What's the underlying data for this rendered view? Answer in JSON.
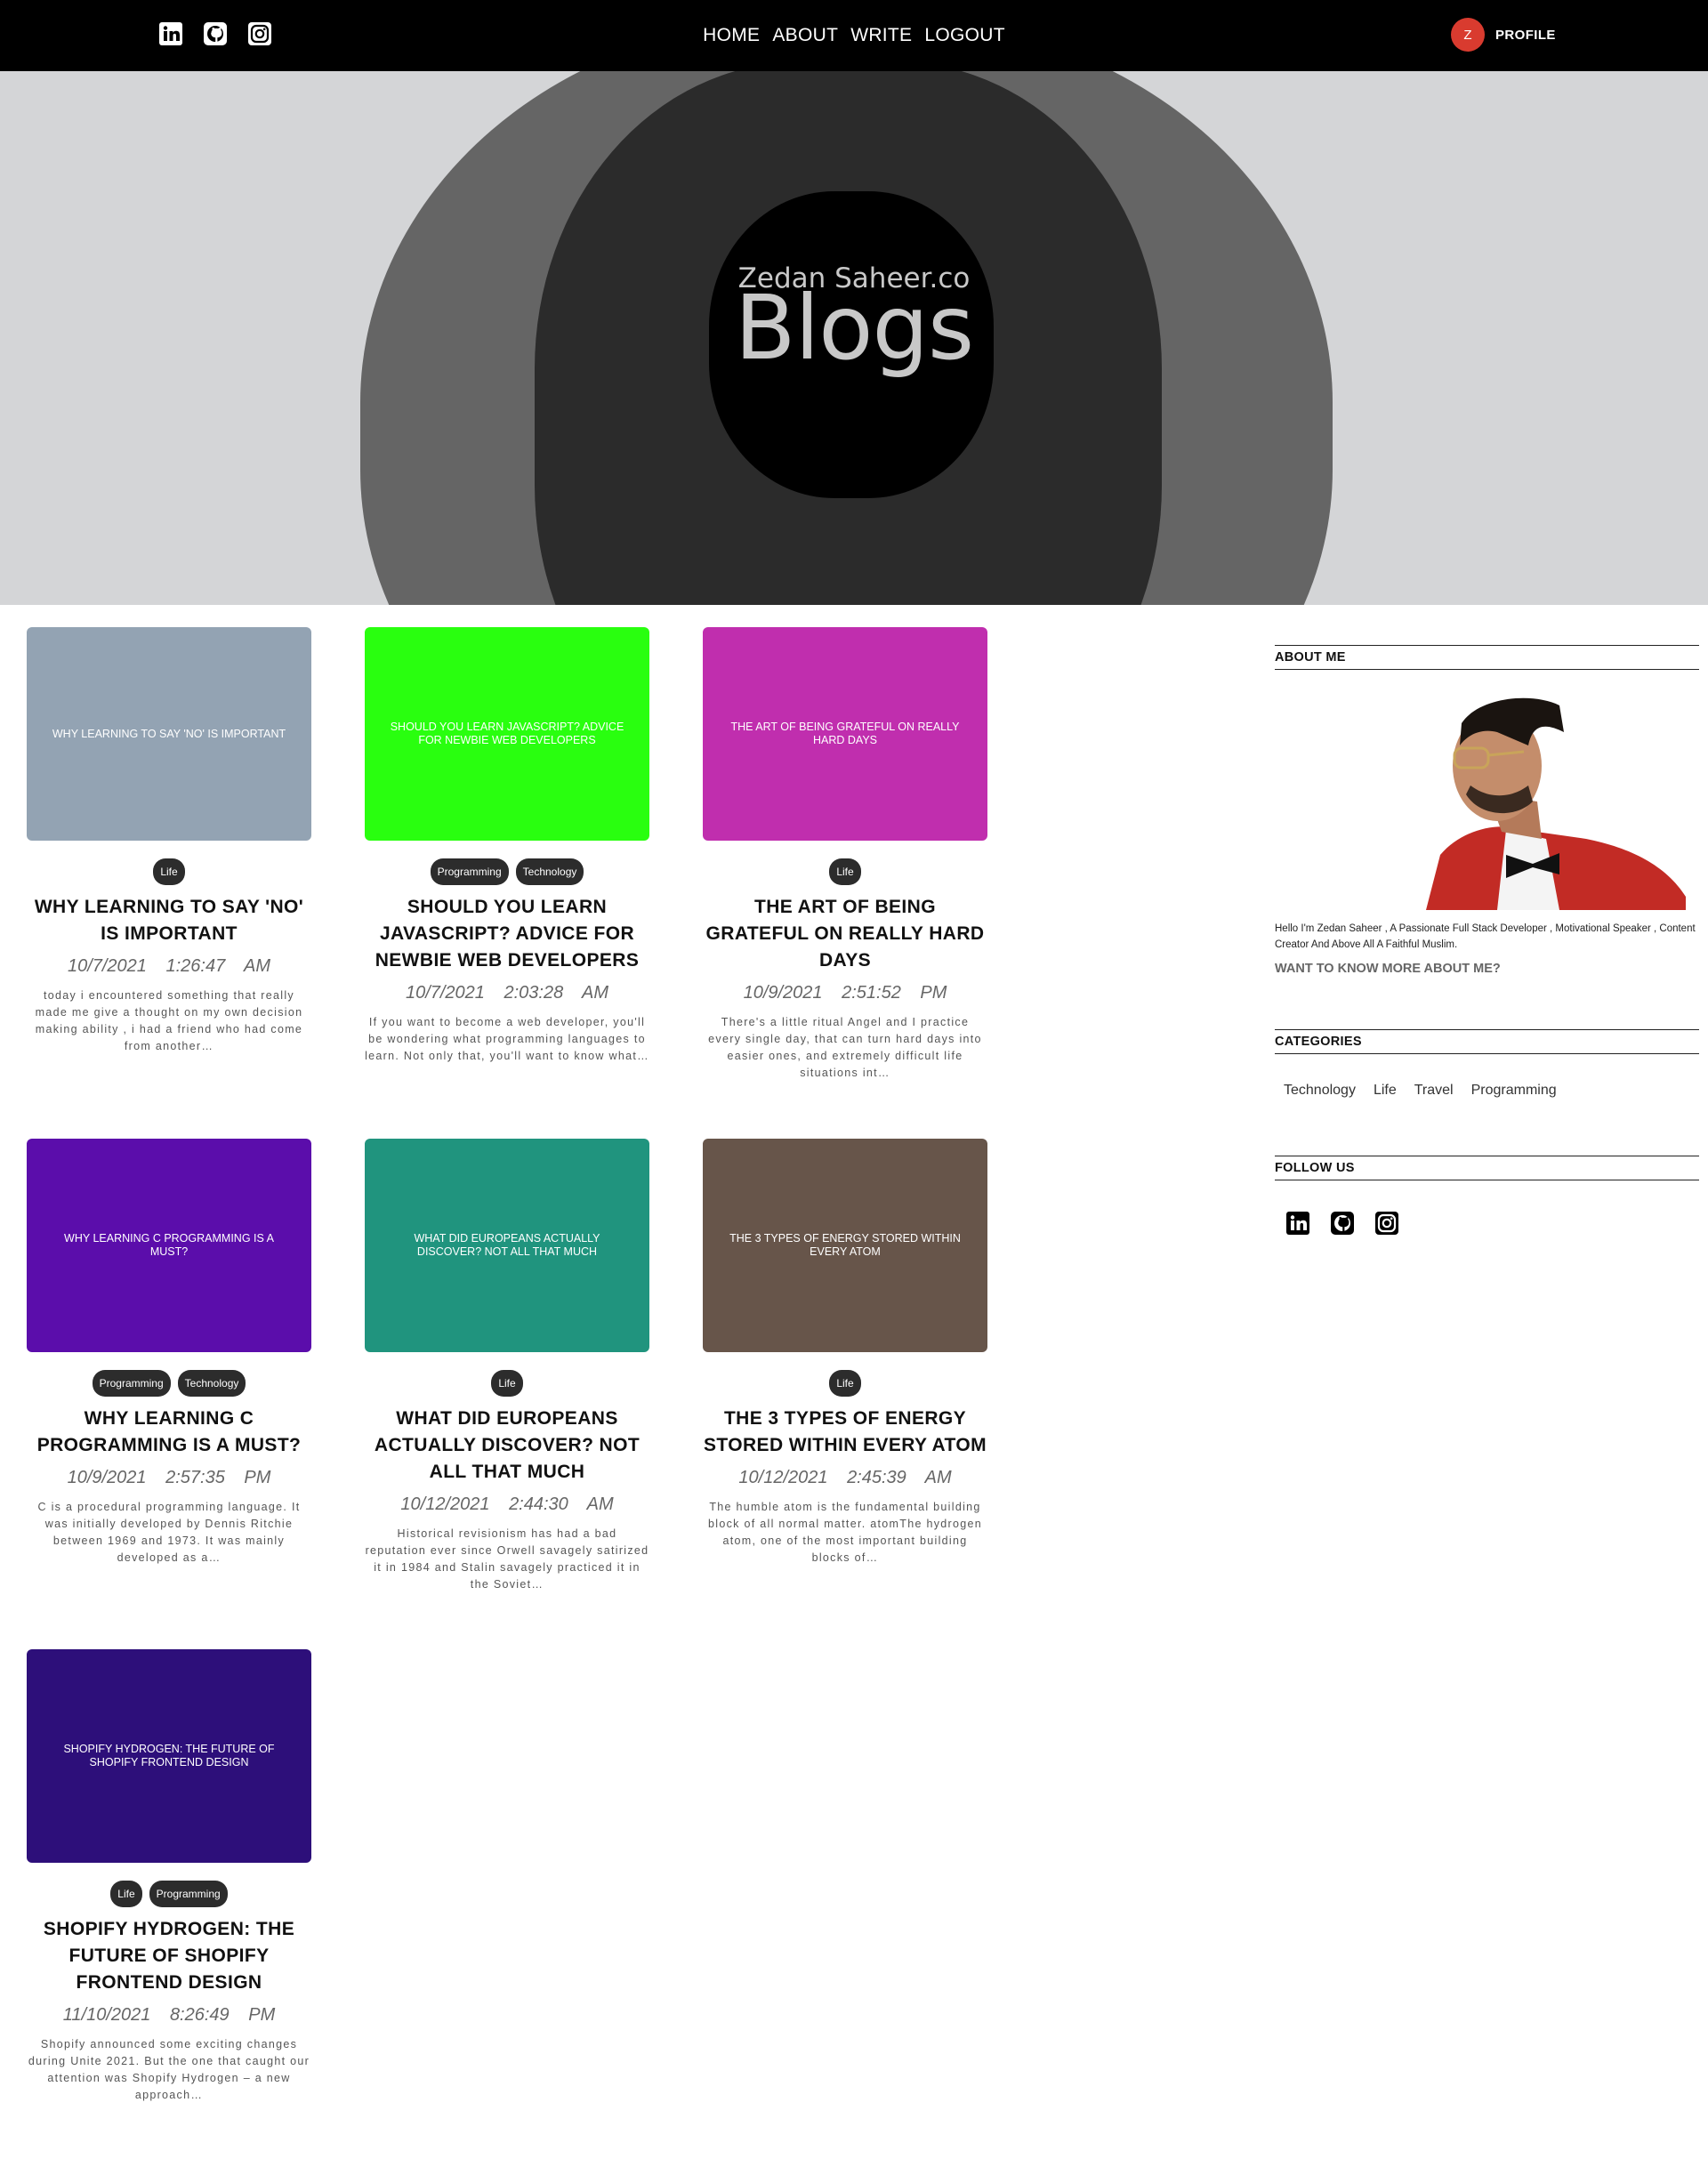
{
  "header": {
    "social_icons": [
      "linkedin-icon",
      "github-icon",
      "instagram-icon"
    ],
    "nav": [
      "HOME",
      "ABOUT",
      "WRITE",
      "LOGOUT"
    ],
    "profile": {
      "avatar_initial": "Z",
      "label": "PROFILE",
      "avatar_color": "#d93b2f"
    }
  },
  "hero": {
    "subtitle": "Zedan Saheer.co",
    "title": "Blogs"
  },
  "posts": [
    {
      "thumb_text": "WHY LEARNING TO SAY 'NO' IS IMPORTANT",
      "thumb_color": "#93a3b3",
      "tags": [
        "Life"
      ],
      "title": "WHY LEARNING TO SAY 'NO' IS IMPORTANT",
      "date": "10/7/2021",
      "time": "1:26:47 AM",
      "desc": "today i encountered something that really made me give a thought on my own decision making ability , i had a friend who had come from another…"
    },
    {
      "thumb_text": "SHOULD YOU LEARN JAVASCRIPT? ADVICE FOR NEWBIE WEB DEVELOPERS",
      "thumb_color": "#29ff0f",
      "tags": [
        "Programming",
        "Technology"
      ],
      "title": "SHOULD YOU LEARN JAVASCRIPT? ADVICE FOR NEWBIE WEB DEVELOPERS",
      "date": "10/7/2021",
      "time": "2:03:28 AM",
      "desc": "If you want to become a web developer, you'll be wondering what programming languages to learn. Not only that, you'll want to know what…"
    },
    {
      "thumb_text": "THE ART OF BEING GRATEFUL ON REALLY HARD DAYS",
      "thumb_color": "#c02eae",
      "tags": [
        "Life"
      ],
      "title": "THE ART OF BEING GRATEFUL ON REALLY HARD DAYS",
      "date": "10/9/2021",
      "time": "2:51:52 PM",
      "desc": "There's a little ritual Angel and I practice every single day, that can turn hard days into easier ones, and extremely difficult life situations int…"
    },
    {
      "thumb_text": "WHY LEARNING C PROGRAMMING IS A MUST?",
      "thumb_color": "#5b0dab",
      "tags": [
        "Programming",
        "Technology"
      ],
      "title": "WHY LEARNING C PROGRAMMING IS A MUST?",
      "date": "10/9/2021",
      "time": "2:57:35 PM",
      "desc": "C is a procedural programming language. It was initially developed by Dennis Ritchie between 1969 and 1973. It was mainly developed as a…"
    },
    {
      "thumb_text": "WHAT DID EUROPEANS ACTUALLY DISCOVER? NOT ALL THAT MUCH",
      "thumb_color": "#20947e",
      "tags": [
        "Life"
      ],
      "title": "WHAT DID EUROPEANS ACTUALLY DISCOVER? NOT ALL THAT MUCH",
      "date": "10/12/2021",
      "time": "2:44:30 AM",
      "desc": "Historical revisionism has had a bad reputation ever since Orwell savagely satirized it in 1984 and Stalin savagely practiced it in the Soviet…"
    },
    {
      "thumb_text": "THE 3 TYPES OF ENERGY STORED WITHIN EVERY ATOM",
      "thumb_color": "#67554a",
      "tags": [
        "Life"
      ],
      "title": "THE 3 TYPES OF ENERGY STORED WITHIN EVERY ATOM",
      "date": "10/12/2021",
      "time": "2:45:39 AM",
      "desc": "The humble atom is the fundamental building block of all normal matter. atomThe hydrogen atom, one of the most important building blocks of…"
    },
    {
      "thumb_text": "SHOPIFY HYDROGEN: THE FUTURE OF SHOPIFY FRONTEND DESIGN",
      "thumb_color": "#2d0f7a",
      "tags": [
        "Life",
        "Programming"
      ],
      "title": "SHOPIFY HYDROGEN: THE FUTURE OF SHOPIFY FRONTEND DESIGN",
      "date": "11/10/2021",
      "time": "8:26:49 PM",
      "desc": "Shopify announced some exciting changes during Unite 2021. But the one that caught our attention was Shopify Hydrogen – a new approach…"
    }
  ],
  "sidebar": {
    "about": {
      "heading": "ABOUT ME",
      "text": "Hello I'm Zedan Saheer , A Passionate Full Stack Developer , Motivational Speaker , Content Creator And Above All A Faithful Muslim.",
      "more": "WANT TO KNOW MORE ABOUT ME?"
    },
    "categories": {
      "heading": "CATEGORIES",
      "items": [
        "Technology",
        "Life",
        "Travel",
        "Programming"
      ]
    },
    "follow": {
      "heading": "FOLLOW US",
      "icons": [
        "linkedin-icon",
        "github-icon",
        "instagram-icon"
      ]
    }
  }
}
